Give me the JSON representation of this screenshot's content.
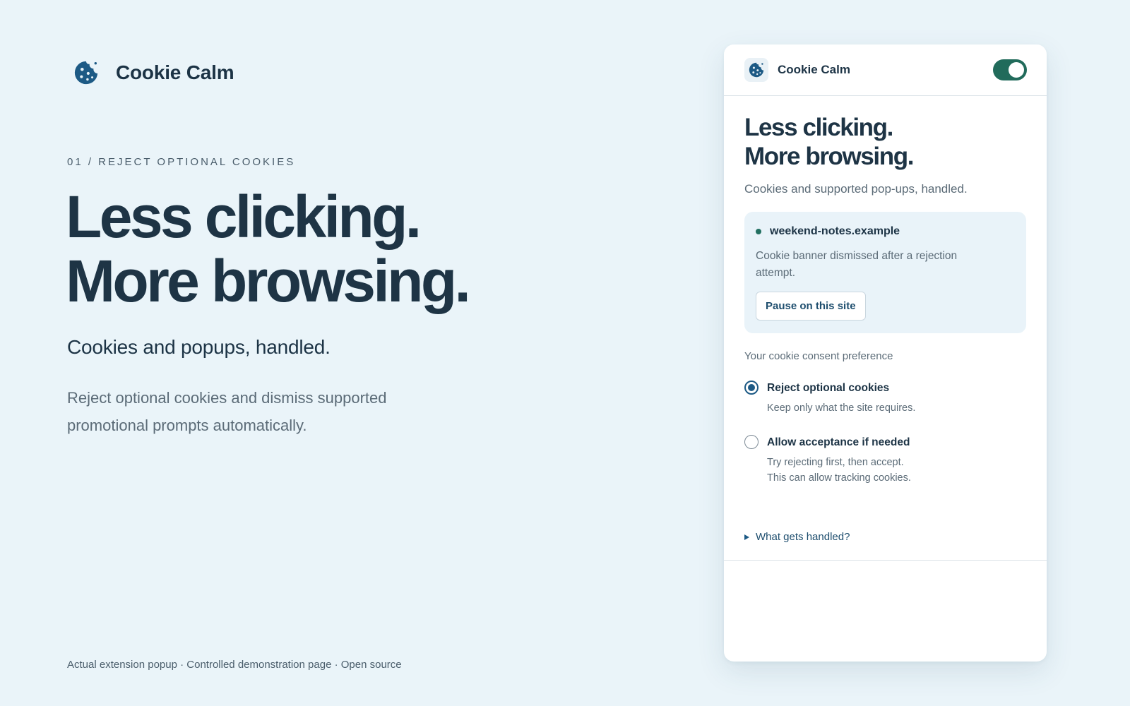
{
  "brand": {
    "name": "Cookie Calm",
    "icon": "cookie-icon"
  },
  "hero": {
    "eyebrow": "01 / REJECT OPTIONAL COOKIES",
    "title_line1": "Less clicking.",
    "title_line2": "More browsing.",
    "subtitle": "Cookies and popups, handled.",
    "body": "Reject optional cookies and dismiss supported promotional prompts automatically."
  },
  "footnote": "Actual extension popup · Controlled demonstration page · Open source",
  "popup": {
    "app_name": "Cookie Calm",
    "enabled": true,
    "title_line1": "Less clicking.",
    "title_line2": "More browsing.",
    "subtitle": "Cookies and supported pop-ups, handled.",
    "site": {
      "domain": "weekend-notes.example",
      "status_color": "#227061",
      "message": "Cookie banner dismissed after a rejection attempt.",
      "pause_label": "Pause on this site"
    },
    "preference_label": "Your cookie consent preference",
    "options": [
      {
        "title": "Reject optional cookies",
        "desc_line1": "Keep only what the site requires.",
        "desc_line2": "",
        "selected": true
      },
      {
        "title": "Allow acceptance if needed",
        "desc_line1": "Try rejecting first, then accept.",
        "desc_line2": "This can allow tracking cookies.",
        "selected": false
      }
    ],
    "details_label": "What gets handled?"
  },
  "colors": {
    "background": "#eaf4f9",
    "text_dark": "#1c3345",
    "accent_green": "#216b5b",
    "accent_blue": "#1d5a85"
  }
}
